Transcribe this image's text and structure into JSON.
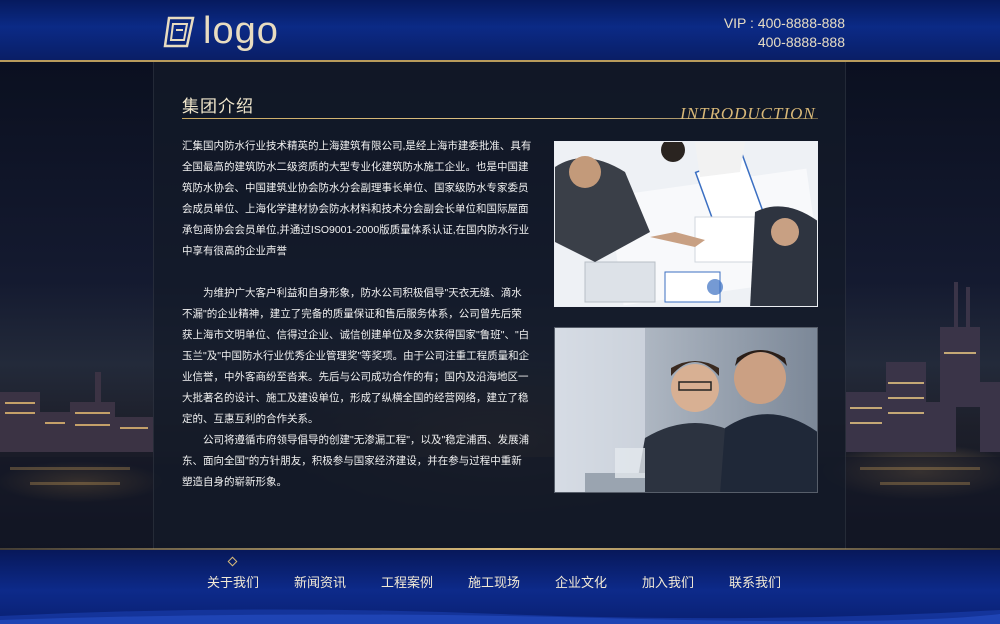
{
  "header": {
    "logo_text": "logo",
    "vip_label": "VIP : 400-8888-888",
    "phone_2": "400-8888-888"
  },
  "section": {
    "title": "集团介绍",
    "title_en": "INTRODUCTION"
  },
  "intro": {
    "paragraph_1": "汇集国内防水行业技术精英的上海建筑有限公司,是经上海市建委批准、具有全国最高的建筑防水二级资质的大型专业化建筑防水施工企业。也是中国建筑防水协会、中国建筑业协会防水分会副理事长单位、国家级防水专家委员会成员单位、上海化学建材协会防水材料和技术分会副会长单位和国际屋面承包商协会会员单位,并通过ISO9001-2000版质量体系认证,在国内防水行业中享有很高的企业声誉",
    "paragraph_2": "为维护广大客户利益和自身形象，防水公司积极倡导\"天衣无缝、滴水不漏\"的企业精神，建立了完备的质量保证和售后服务体系，公司曾先后荣获上海市文明单位、信得过企业、诚信创建单位及多次获得国家\"鲁班\"、\"白玉兰\"及\"中国防水行业优秀企业管理奖\"等奖项。由于公司注重工程质量和企业信誉，中外客商纷至沓来。先后与公司成功合作的有；国内及沿海地区一大批著名的设计、施工及建设单位，形成了纵横全国的经营网络，建立了稳定的、互惠互利的合作关系。",
    "paragraph_3": "公司将遵循市府领导倡导的创建\"无渗漏工程\"，以及\"稳定浦西、发展浦东、面向全国\"的方针朋友，积极参与国家经济建设，并在参与过程中重新塑造自身的崭新形象。"
  },
  "nav": {
    "items": [
      "关于我们",
      "新闻资讯",
      "工程案例",
      "施工现场",
      "企业文化",
      "加入我们",
      "联系我们"
    ],
    "active_index": 0
  },
  "colors": {
    "header_blue": "#0b2a86",
    "gold": "#d9bb7a",
    "nav_text": "#f2ead6"
  }
}
